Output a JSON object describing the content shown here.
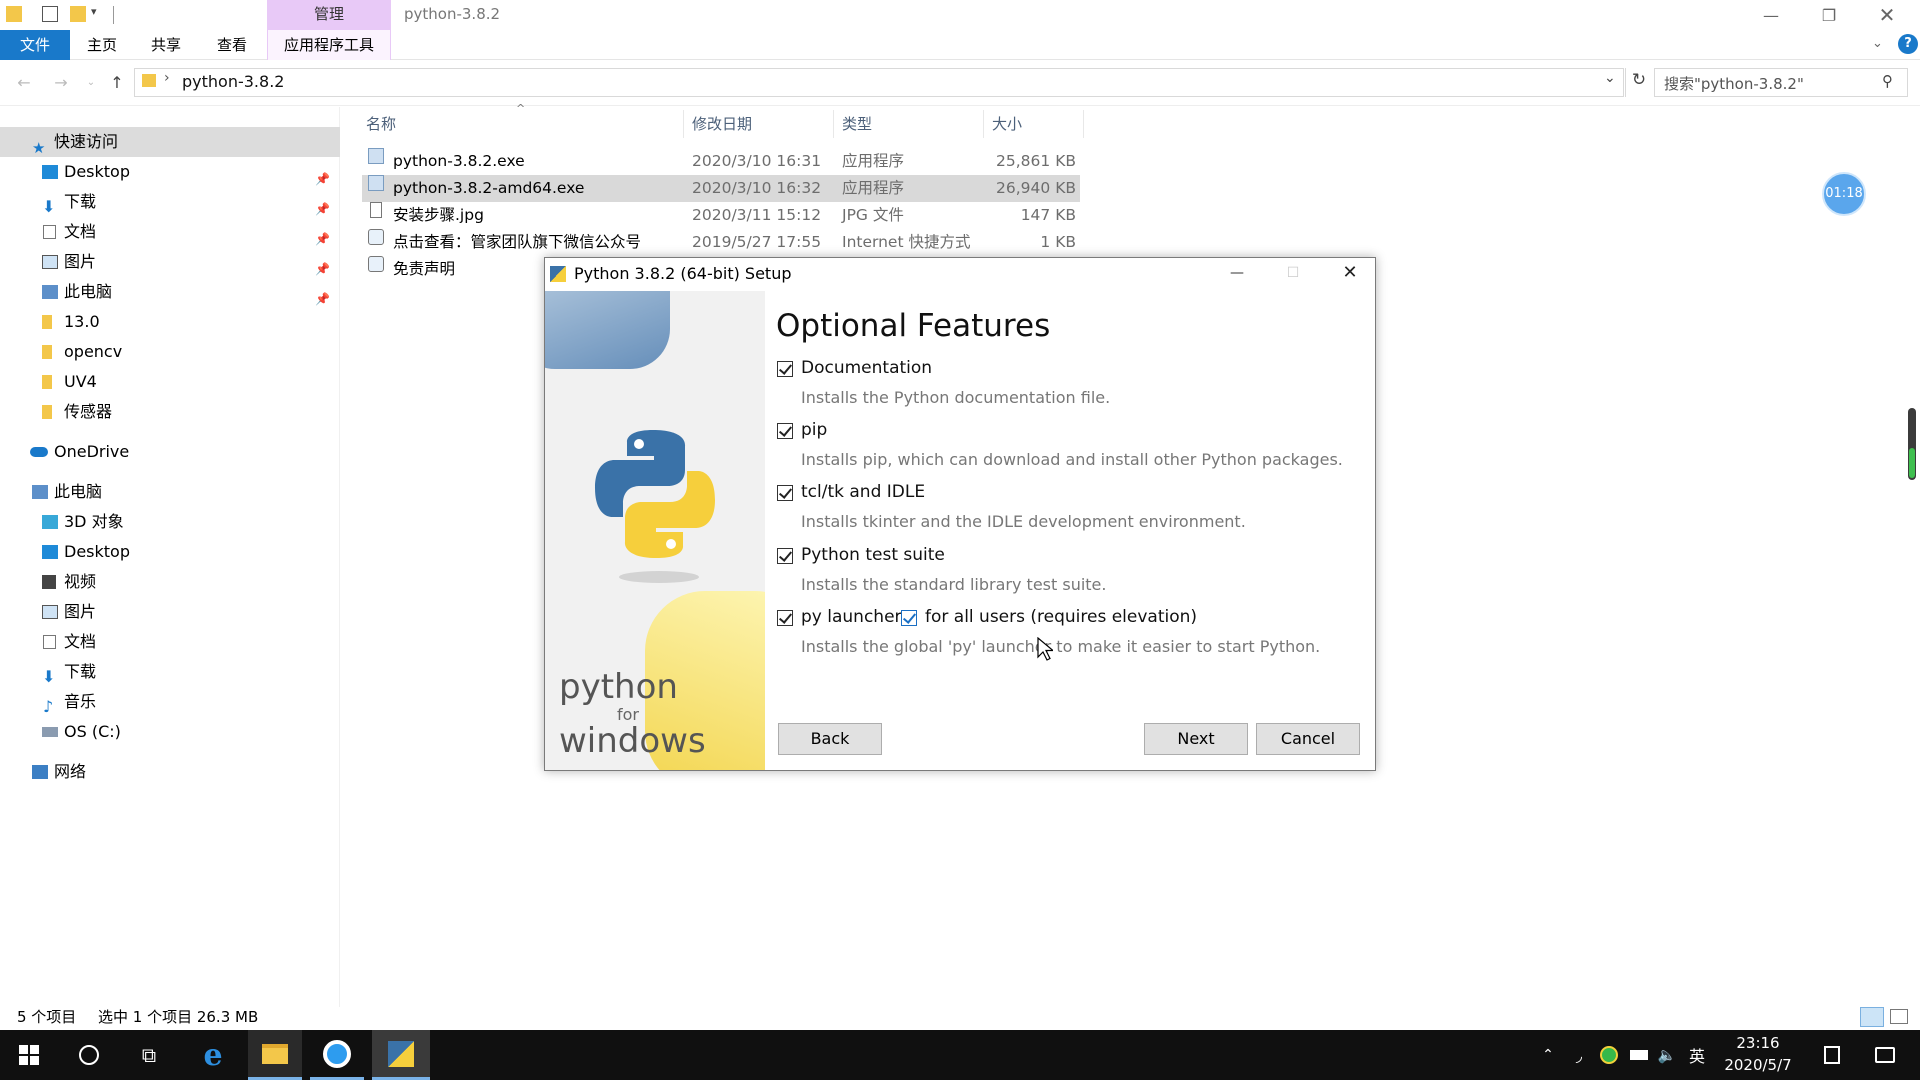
{
  "explorer": {
    "manage_label": "管理",
    "window_title": "python-3.8.2",
    "tabs": [
      "文件",
      "主页",
      "共享",
      "查看",
      "应用程序工具"
    ],
    "address": "python-3.8.2",
    "search_placeholder": "搜索\"python-3.8.2\"",
    "nav": {
      "quick_access": "快速访问",
      "quick_items": [
        "Desktop",
        "下载",
        "文档",
        "图片",
        "此电脑",
        "13.0",
        "opencv",
        "UV4",
        "传感器"
      ],
      "onedrive": "OneDrive",
      "this_pc": "此电脑",
      "pc_items": [
        "3D 对象",
        "Desktop",
        "视频",
        "图片",
        "文档",
        "下载",
        "音乐",
        "OS (C:)"
      ],
      "network": "网络"
    },
    "columns": [
      "名称",
      "修改日期",
      "类型",
      "大小"
    ],
    "files": [
      {
        "name": "python-3.8.2.exe",
        "date": "2020/3/10 16:31",
        "type": "应用程序",
        "size": "25,861 KB"
      },
      {
        "name": "python-3.8.2-amd64.exe",
        "date": "2020/3/10 16:32",
        "type": "应用程序",
        "size": "26,940 KB"
      },
      {
        "name": "安装步骤.jpg",
        "date": "2020/3/11 15:12",
        "type": "JPG 文件",
        "size": "147 KB"
      },
      {
        "name": "点击查看：管家团队旗下微信公众号",
        "date": "2019/5/27 17:55",
        "type": "Internet 快捷方式",
        "size": "1 KB"
      },
      {
        "name": "免责声明",
        "date": "",
        "type": "",
        "size": ""
      }
    ],
    "status_count": "5 个项目",
    "status_selected": "选中 1 个项目  26.3 MB"
  },
  "timer_badge": "01:18",
  "dialog": {
    "title": "Python 3.8.2 (64-bit) Setup",
    "heading": "Optional Features",
    "options": [
      {
        "label": "Documentation",
        "desc": "Installs the Python documentation file."
      },
      {
        "label": "pip",
        "desc": "Installs pip, which can download and install other Python packages."
      },
      {
        "label": "tcl/tk and IDLE",
        "desc": "Installs tkinter and the IDLE development environment."
      },
      {
        "label": "Python test suite",
        "desc": "Installs the standard library test suite."
      },
      {
        "label": "py launcher",
        "desc": "Installs the global 'py' launcher to make it easier to start Python."
      }
    ],
    "for_all_users": "for all users (requires elevation)",
    "side_text": [
      "python",
      "for",
      "windows"
    ],
    "back": "Back",
    "next": "Next",
    "cancel": "Cancel"
  },
  "taskbar": {
    "ime": "英",
    "time": "23:16",
    "date": "2020/5/7"
  },
  "colors": {
    "ribbon_file": "#1979ca",
    "manage_tab": "#e8c9f7",
    "selected_row": "#d9d9d9",
    "taskbar": "#101010"
  }
}
